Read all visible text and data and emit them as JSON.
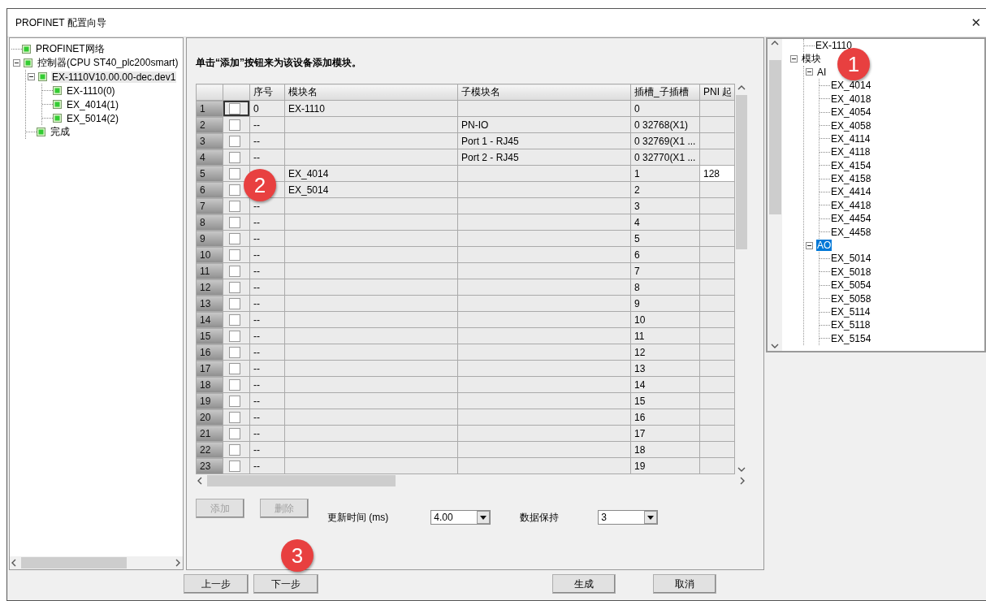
{
  "window": {
    "title": "PROFINET 配置向导",
    "close": "✕"
  },
  "left_tree": {
    "items": [
      {
        "label": "PROFINET网络",
        "selected": false
      },
      {
        "label": "控制器(CPU ST40_plc200smart)",
        "selected": false,
        "expanded": true,
        "children": [
          {
            "label": "EX-1110V10.00.00-dec.dev1",
            "selected": true,
            "expanded": true,
            "children": [
              {
                "label": "EX-1110(0)",
                "selected": false
              },
              {
                "label": "EX_4014(1)",
                "selected": false
              },
              {
                "label": "EX_5014(2)",
                "selected": false
              }
            ]
          },
          {
            "label": "完成",
            "selected": false
          }
        ]
      }
    ]
  },
  "instruction": "单击“添加”按钮来为该设备添加模块。",
  "table": {
    "columns": [
      "",
      "",
      "序号",
      "模块名",
      "子模块名",
      "插槽_子插槽",
      "PNI 起"
    ],
    "rows": [
      {
        "row_number": "1",
        "checked": false,
        "focused": true,
        "seq": "0",
        "module": "EX-1110",
        "slot": "0"
      },
      {
        "row_number": "2",
        "checked": false,
        "focused": false,
        "seq": "--",
        "submodule": "PN-IO",
        "slot": "0 32768(X1)"
      },
      {
        "row_number": "3",
        "checked": false,
        "focused": false,
        "seq": "--",
        "submodule": "Port 1 - RJ45",
        "slot": "0 32769(X1 ..."
      },
      {
        "row_number": "4",
        "checked": false,
        "focused": false,
        "seq": "--",
        "submodule": "Port 2 - RJ45",
        "slot": "0 32770(X1 ..."
      },
      {
        "row_number": "5",
        "checked": false,
        "focused": false,
        "module": "EX_4014",
        "slot": "1",
        "pni": "128"
      },
      {
        "row_number": "6",
        "checked": false,
        "focused": false,
        "module": "EX_5014",
        "slot": "2"
      },
      {
        "row_number": "7",
        "checked": false,
        "focused": false,
        "seq": "--",
        "slot": "3"
      },
      {
        "row_number": "8",
        "checked": false,
        "focused": false,
        "seq": "--",
        "slot": "4"
      },
      {
        "row_number": "9",
        "checked": false,
        "focused": false,
        "seq": "--",
        "slot": "5"
      },
      {
        "row_number": "10",
        "checked": false,
        "focused": false,
        "seq": "--",
        "slot": "6"
      },
      {
        "row_number": "11",
        "checked": false,
        "focused": false,
        "seq": "--",
        "slot": "7"
      },
      {
        "row_number": "12",
        "checked": false,
        "focused": false,
        "seq": "--",
        "slot": "8"
      },
      {
        "row_number": "13",
        "checked": false,
        "focused": false,
        "seq": "--",
        "slot": "9"
      },
      {
        "row_number": "14",
        "checked": false,
        "focused": false,
        "seq": "--",
        "slot": "10"
      },
      {
        "row_number": "15",
        "checked": false,
        "focused": false,
        "seq": "--",
        "slot": "11"
      },
      {
        "row_number": "16",
        "checked": false,
        "focused": false,
        "seq": "--",
        "slot": "12"
      },
      {
        "row_number": "17",
        "checked": false,
        "focused": false,
        "seq": "--",
        "slot": "13"
      },
      {
        "row_number": "18",
        "checked": false,
        "focused": false,
        "seq": "--",
        "slot": "14"
      },
      {
        "row_number": "19",
        "checked": false,
        "focused": false,
        "seq": "--",
        "slot": "15"
      },
      {
        "row_number": "20",
        "checked": false,
        "focused": false,
        "seq": "--",
        "slot": "16"
      },
      {
        "row_number": "21",
        "checked": false,
        "focused": false,
        "seq": "--",
        "slot": "17"
      },
      {
        "row_number": "22",
        "checked": false,
        "focused": false,
        "seq": "--",
        "slot": "18"
      },
      {
        "row_number": "23",
        "checked": false,
        "focused": false,
        "seq": "--",
        "slot": "19"
      }
    ]
  },
  "add_button": {
    "label": "添加",
    "disabled": true
  },
  "delete_button": {
    "label": "删除",
    "disabled": true
  },
  "update_time": {
    "label": "更新时间 (ms)",
    "value": "4.00"
  },
  "data_hold": {
    "label": "数据保持",
    "value": "3"
  },
  "right_tree": {
    "items": [
      {
        "children": [
          {
            "label": "EX-1110",
            "selected": false
          }
        ]
      },
      {
        "label": "模块",
        "selected": false,
        "expanded": true,
        "children": [
          {
            "label": "AI",
            "selected": false,
            "expanded": true,
            "children": [
              {
                "label": "EX_4014",
                "selected": false
              },
              {
                "label": "EX_4018",
                "selected": false
              },
              {
                "label": "EX_4054",
                "selected": false
              },
              {
                "label": "EX_4058",
                "selected": false
              },
              {
                "label": "EX_4114",
                "selected": false
              },
              {
                "label": "EX_4118",
                "selected": false
              },
              {
                "label": "EX_4154",
                "selected": false
              },
              {
                "label": "EX_4158",
                "selected": false
              },
              {
                "label": "EX_4414",
                "selected": false
              },
              {
                "label": "EX_4418",
                "selected": false
              },
              {
                "label": "EX_4454",
                "selected": false
              },
              {
                "label": "EX_4458",
                "selected": false
              }
            ]
          },
          {
            "label": "AO",
            "selected": true,
            "expanded": true,
            "children": [
              {
                "label": "EX_5014",
                "selected": false
              },
              {
                "label": "EX_5018",
                "selected": false
              },
              {
                "label": "EX_5054",
                "selected": false
              },
              {
                "label": "EX_5058",
                "selected": false
              },
              {
                "label": "EX_5114",
                "selected": false
              },
              {
                "label": "EX_5118",
                "selected": false
              },
              {
                "label": "EX_5154",
                "selected": false
              }
            ]
          }
        ]
      }
    ]
  },
  "footer_buttons": [
    {
      "label": "上一步",
      "kind": "nav"
    },
    {
      "label": "下一步",
      "kind": "nav"
    },
    {
      "label": "生成",
      "kind": "action"
    },
    {
      "label": "取消",
      "kind": "action"
    }
  ],
  "annotations": [
    {
      "label": "1"
    },
    {
      "label": "2"
    },
    {
      "label": "3"
    }
  ]
}
